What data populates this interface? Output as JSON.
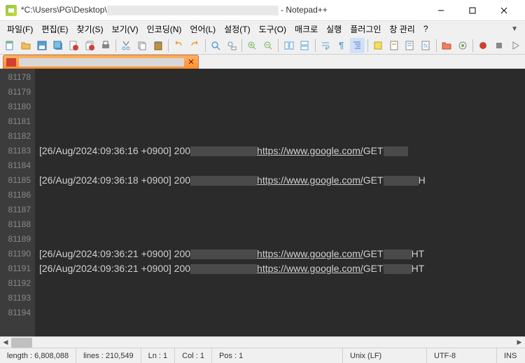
{
  "window": {
    "title_prefix": "*C:\\Users\\PG\\Desktop\\",
    "title_suffix": " - Notepad++"
  },
  "menus": {
    "file": "파일(F)",
    "edit": "편집(E)",
    "search": "찾기(S)",
    "view": "보기(V)",
    "encoding": "인코딩(N)",
    "language": "언어(L)",
    "settings": "설정(T)",
    "tools": "도구(O)",
    "macro": "매크로",
    "run": "실행",
    "plugins": "플러그인",
    "window": "창 관리",
    "help": "?"
  },
  "lines": [
    {
      "no": "81178",
      "content": "",
      "redact_before": 0,
      "url": "",
      "method": "",
      "redact_after": 0,
      "tail": ""
    },
    {
      "no": "81179",
      "content": "",
      "redact_before": 0,
      "url": "",
      "method": "",
      "redact_after": 0,
      "tail": ""
    },
    {
      "no": "81180",
      "content": "",
      "redact_before": 0,
      "url": "",
      "method": "",
      "redact_after": 0,
      "tail": ""
    },
    {
      "no": "81181",
      "content": "",
      "redact_before": 0,
      "url": "",
      "method": "",
      "redact_after": 0,
      "tail": ""
    },
    {
      "no": "81182",
      "content": "",
      "redact_before": 0,
      "url": "",
      "method": "",
      "redact_after": 0,
      "tail": ""
    },
    {
      "no": "81183",
      "content": "[26/Aug/2024:09:36:16 +0900] 200 ",
      "redact_before": 95,
      "url": "https://www.google.com/",
      "method": " GET ",
      "redact_after": 35,
      "tail": ""
    },
    {
      "no": "81184",
      "content": "",
      "redact_before": 0,
      "url": "",
      "method": "",
      "redact_after": 0,
      "tail": ""
    },
    {
      "no": "81185",
      "content": "[26/Aug/2024:09:36:18 +0900] 200 ",
      "redact_before": 95,
      "url": "https://www.google.com/",
      "method": " GET",
      "redact_after": 50,
      "tail": "H"
    },
    {
      "no": "81186",
      "content": "",
      "redact_before": 0,
      "url": "",
      "method": "",
      "redact_after": 0,
      "tail": ""
    },
    {
      "no": "81187",
      "content": "",
      "redact_before": 0,
      "url": "",
      "method": "",
      "redact_after": 0,
      "tail": ""
    },
    {
      "no": "81188",
      "content": "",
      "redact_before": 0,
      "url": "",
      "method": "",
      "redact_after": 0,
      "tail": ""
    },
    {
      "no": "81189",
      "content": "",
      "redact_before": 0,
      "url": "",
      "method": "",
      "redact_after": 0,
      "tail": ""
    },
    {
      "no": "81190",
      "content": "[26/Aug/2024:09:36:21 +0900] 200 ",
      "redact_before": 95,
      "url": "https://www.google.com/",
      "method": " GET ",
      "redact_after": 40,
      "tail": " HT"
    },
    {
      "no": "81191",
      "content": "[26/Aug/2024:09:36:21 +0900] 200 ",
      "redact_before": 95,
      "url": "https://www.google.com/",
      "method": " GET ",
      "redact_after": 40,
      "tail": " HT"
    },
    {
      "no": "81192",
      "content": "",
      "redact_before": 0,
      "url": "",
      "method": "",
      "redact_after": 0,
      "tail": ""
    },
    {
      "no": "81193",
      "content": "",
      "redact_before": 0,
      "url": "",
      "method": "",
      "redact_after": 0,
      "tail": ""
    },
    {
      "no": "81194",
      "content": "",
      "redact_before": 0,
      "url": "",
      "method": "",
      "redact_after": 0,
      "tail": ""
    }
  ],
  "status": {
    "length": "length : 6,808,088",
    "lines": "lines : 210,549",
    "ln": "Ln : 1",
    "col": "Col : 1",
    "pos": "Pos : 1",
    "eol": "Unix (LF)",
    "encoding": "UTF-8",
    "mode": "INS"
  }
}
